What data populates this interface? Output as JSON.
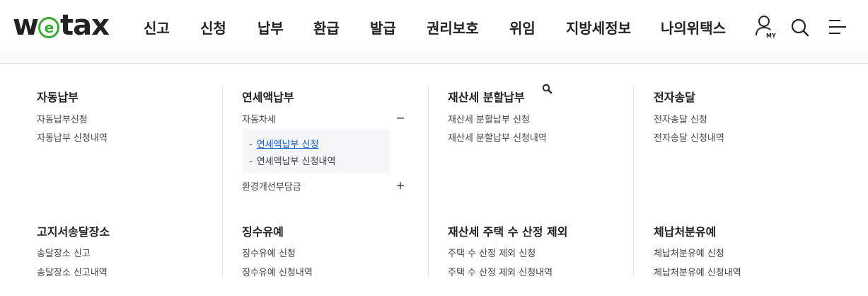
{
  "header": {
    "logo": {
      "w": "w",
      "e": "e",
      "tax": "tax"
    },
    "nav": [
      "신고",
      "신청",
      "납부",
      "환급",
      "발급",
      "권리보호",
      "위임",
      "지방세정보",
      "나의위택스"
    ],
    "icons": {
      "my": "my-user-icon",
      "my_label": "MY",
      "search": "search-icon",
      "menu": "menu-icon"
    }
  },
  "menu": {
    "auto_pay": {
      "title": "자동납부",
      "links": [
        "자동납부신청",
        "자동납부 신청내역"
      ]
    },
    "annual_pay": {
      "title": "연세액납부",
      "car_tax": {
        "label": "자동차세",
        "toggle": "−"
      },
      "sub_links": [
        "연세액납부 신청",
        "연세액납부 신청내역"
      ],
      "env_charge": {
        "label": "환경개선부담금",
        "toggle": "+"
      }
    },
    "property_split": {
      "title": "재산세 분할납부",
      "links": [
        "재산세 분할납부 신청",
        "재산세 분할납부 신청내역"
      ]
    },
    "e_delivery": {
      "title": "전자송달",
      "links": [
        "전자송달 신청",
        "전자송달 신청내역"
      ]
    },
    "notice_place": {
      "title": "고지서송달장소",
      "links": [
        "송달장소 신고",
        "송달장소 신고내역"
      ]
    },
    "collection_grace": {
      "title": "징수유예",
      "links": [
        "징수유예 신청",
        "징수유예 신청내역"
      ]
    },
    "property_house": {
      "title": "재산세 주택 수 산정 제외",
      "links": [
        "주택 수 산정 제외 신청",
        "주택 수 산정 제외 신청내역"
      ]
    },
    "arrears_grace": {
      "title": "체납처분유예",
      "links": [
        "체납처분유예 신청",
        "체납처분유예 신청내역"
      ]
    }
  },
  "colors": {
    "brand_green": "#3aaa35",
    "active_link": "#1a5fc8",
    "submenu_bg": "#f5f6f8"
  }
}
